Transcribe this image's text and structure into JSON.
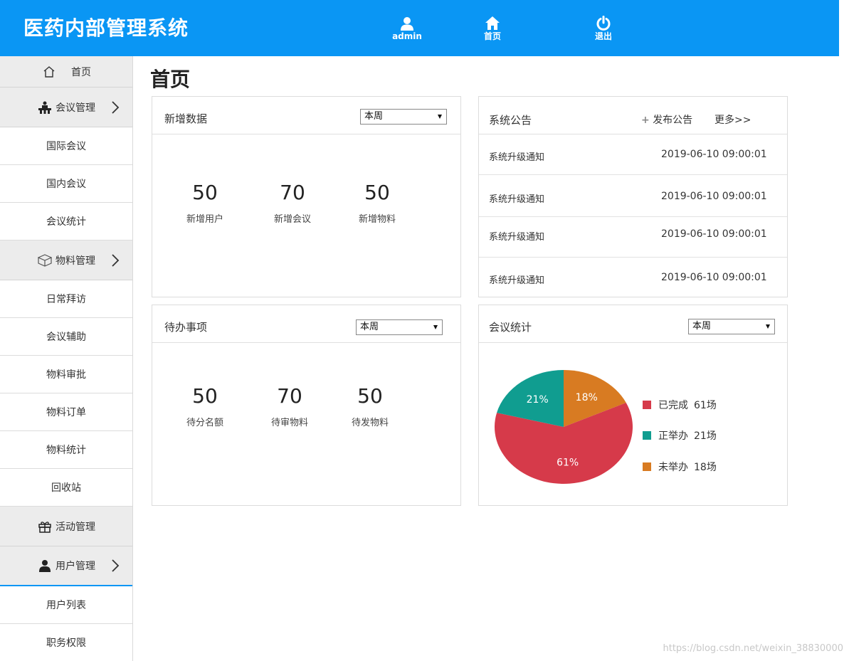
{
  "app": {
    "title": "医药内部管理系统",
    "accent": "#0a96f4"
  },
  "header_nav": [
    {
      "label": "admin",
      "icon": "user-icon"
    },
    {
      "label": "首页",
      "icon": "home-icon"
    },
    {
      "label": "退出",
      "icon": "power-icon"
    }
  ],
  "sidebar": {
    "home": {
      "label": "首页",
      "icon": "home-outline-icon"
    },
    "meeting": {
      "label": "会议管理",
      "icon": "meeting-icon",
      "items": [
        "国际会议",
        "国内会议",
        "会议统计"
      ]
    },
    "material": {
      "label": "物料管理",
      "icon": "box-icon",
      "items": [
        "日常拜访",
        "会议辅助",
        "物料审批",
        "物料订单",
        "物料统计",
        "回收站"
      ]
    },
    "activity": {
      "label": "活动管理",
      "icon": "gift-icon"
    },
    "user": {
      "label": "用户管理",
      "icon": "person-icon",
      "items": [
        "用户列表",
        "职务权限"
      ]
    }
  },
  "page": {
    "title": "首页"
  },
  "new_data": {
    "title": "新增数据",
    "period": "本周",
    "stats": [
      {
        "value": "50",
        "label": "新增用户"
      },
      {
        "value": "70",
        "label": "新增会议"
      },
      {
        "value": "50",
        "label": "新增物料"
      }
    ]
  },
  "notice": {
    "title": "系统公告",
    "publish_label": "发布公告",
    "more_label": "更多>>",
    "rows": [
      {
        "title": "系统升级通知",
        "date": "2019-06-10 09:00:01"
      },
      {
        "title": "系统升级通知",
        "date": "2019-06-10 09:00:01"
      },
      {
        "title": "系统升级通知",
        "date": "2019-06-10 09:00:01"
      },
      {
        "title": "系统升级通知",
        "date": "2019-06-10 09:00:01"
      }
    ]
  },
  "todo": {
    "title": "待办事项",
    "period": "本周",
    "stats": [
      {
        "value": "50",
        "label": "待分名额"
      },
      {
        "value": "70",
        "label": "待审物料"
      },
      {
        "value": "50",
        "label": "待发物料"
      }
    ]
  },
  "meeting_stats": {
    "title": "会议统计",
    "period": "本周"
  },
  "chart_data": {
    "type": "pie",
    "title": "",
    "slices": [
      {
        "name": "已完成",
        "value": 61,
        "unit": "场",
        "percent_label": "61%",
        "color": "#d63a4a"
      },
      {
        "name": "正举办",
        "value": 21,
        "unit": "场",
        "percent_label": "21%",
        "color": "#109d90"
      },
      {
        "name": "未举办",
        "value": 18,
        "unit": "场",
        "percent_label": "18%",
        "color": "#d87b22"
      }
    ],
    "legend_position": "right"
  },
  "watermark": "https://blog.csdn.net/weixin_38830000"
}
